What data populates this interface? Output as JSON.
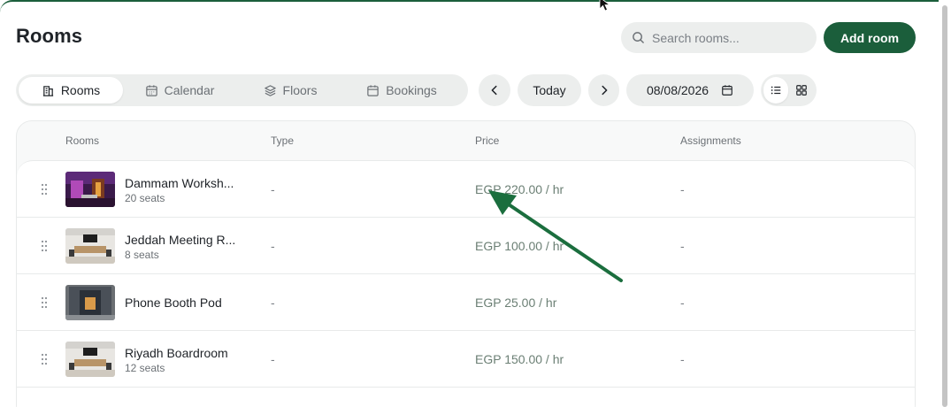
{
  "page": {
    "title": "Rooms"
  },
  "search": {
    "placeholder": "Search rooms..."
  },
  "actions": {
    "add_room_label": "Add room"
  },
  "tabs": [
    {
      "label": "Rooms",
      "icon": "building-icon",
      "active": true
    },
    {
      "label": "Calendar",
      "icon": "calendar-icon",
      "active": false
    },
    {
      "label": "Floors",
      "icon": "layers-icon",
      "active": false
    },
    {
      "label": "Bookings",
      "icon": "calendar-icon",
      "active": false
    }
  ],
  "date_nav": {
    "today_label": "Today",
    "date_value": "08/08/2026"
  },
  "view": {
    "options": [
      "list-view-icon",
      "grid-view-icon"
    ],
    "active": "list-view-icon"
  },
  "table": {
    "columns": [
      "Rooms",
      "Type",
      "Price",
      "Assignments"
    ],
    "rows": [
      {
        "name": "Dammam Worksh...",
        "seats": "20 seats",
        "type": "-",
        "price": "EGP 220.00 / hr",
        "assignments": "-"
      },
      {
        "name": "Jeddah Meeting R...",
        "seats": "8 seats",
        "type": "-",
        "price": "EGP 100.00 / hr",
        "assignments": "-"
      },
      {
        "name": "Phone Booth Pod",
        "seats": "",
        "type": "-",
        "price": "EGP 25.00 / hr",
        "assignments": "-"
      },
      {
        "name": "Riyadh Boardroom",
        "seats": "12 seats",
        "type": "-",
        "price": "EGP 150.00 / hr",
        "assignments": "-"
      }
    ]
  },
  "colors": {
    "accent": "#1b5e3b",
    "pill_bg": "#eceeed",
    "muted_text": "#6b7075"
  }
}
